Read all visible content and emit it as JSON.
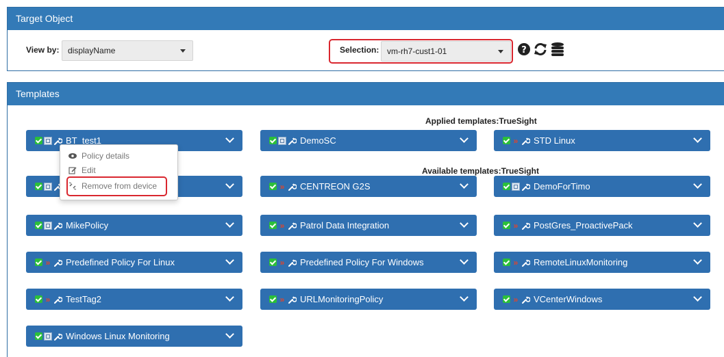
{
  "target_panel": {
    "title": "Target Object",
    "view_by_label": "View by:",
    "view_by_value": "displayName",
    "selection_label": "Selection:",
    "selection_value": "vm-rh7-cust1-01",
    "icons": [
      "help-icon",
      "refresh-icon",
      "database-icon"
    ]
  },
  "templates_panel": {
    "title": "Templates",
    "applied_label": "Applied templates:TrueSight",
    "available_label": "Available templates:TrueSight"
  },
  "templates": [
    {
      "name": "BT_test1",
      "status": "grid"
    },
    {
      "name": "DemoSC",
      "status": "grid"
    },
    {
      "name": "STD Linux",
      "status": "arrow"
    },
    {
      "name": "",
      "status": "grid"
    },
    {
      "name": "CENTREON G2S",
      "status": "arrow"
    },
    {
      "name": "DemoForTimo",
      "status": "grid"
    },
    {
      "name": "MikePolicy",
      "status": "grid"
    },
    {
      "name": "Patrol Data Integration",
      "status": "arrow"
    },
    {
      "name": "PostGres_ProactivePack",
      "status": "arrow"
    },
    {
      "name": "Predefined Policy For Linux",
      "status": "arrow"
    },
    {
      "name": "Predefined Policy For Windows",
      "status": "arrow"
    },
    {
      "name": "RemoteLinuxMonitoring",
      "status": "arrow"
    },
    {
      "name": "TestTag2",
      "status": "arrow"
    },
    {
      "name": "URLMonitoringPolicy",
      "status": "arrow"
    },
    {
      "name": "VCenterWindows",
      "status": "arrow"
    },
    {
      "name": "Windows Linux Monitoring",
      "status": "grid"
    }
  ],
  "context_menu": {
    "policy_details": "Policy details",
    "edit": "Edit",
    "remove": "Remove from device"
  },
  "colors": {
    "accent": "#337ab7",
    "tile": "#2f6fb0",
    "highlight": "#d9262e",
    "ok": "#2bbf3a",
    "warn": "#e0452c"
  }
}
